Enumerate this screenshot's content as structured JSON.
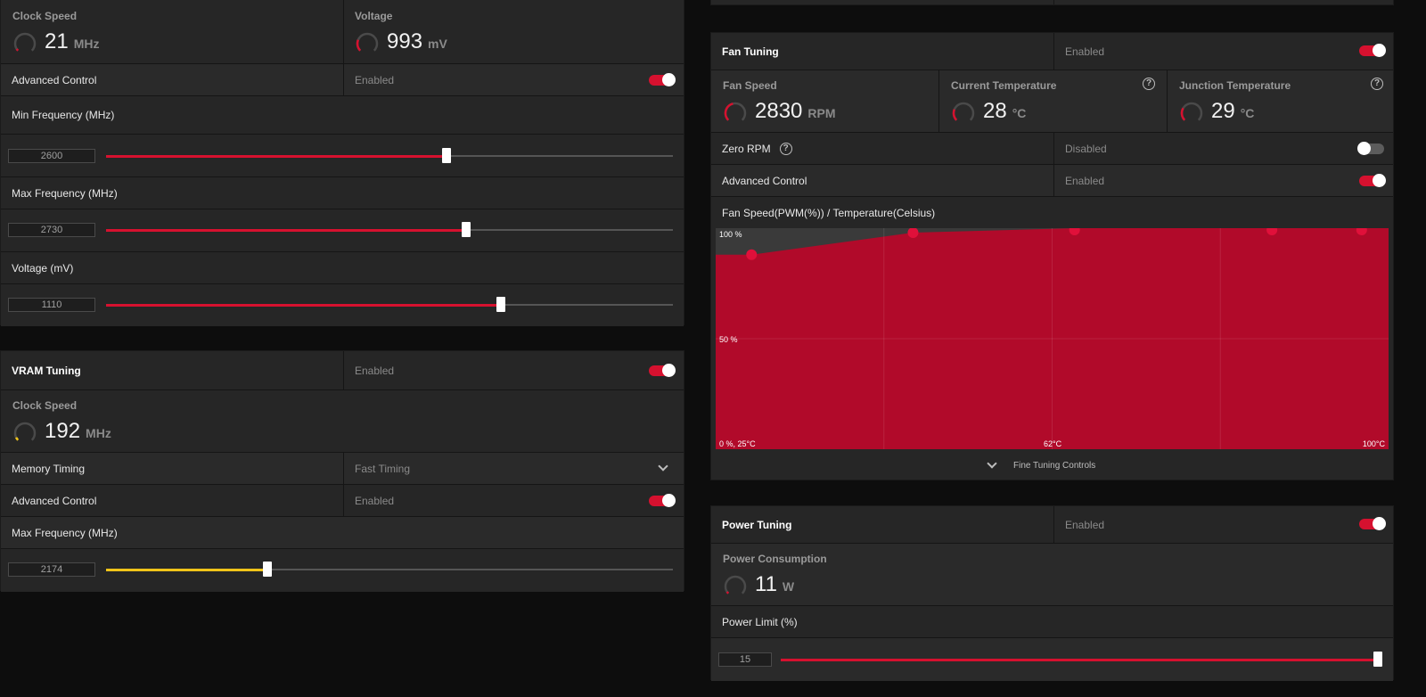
{
  "gpu": {
    "clock": {
      "title": "Clock Speed",
      "value": "21",
      "unit": "MHz",
      "level": 0.0
    },
    "voltage": {
      "title": "Voltage",
      "value": "993",
      "unit": "mV",
      "level": 0.25
    },
    "advanced_label": "Advanced Control",
    "advanced_state": "Enabled",
    "advanced_on": true,
    "sliders": [
      {
        "label": "Min Frequency (MHz)",
        "value": "2600",
        "fraction": 0.6
      },
      {
        "label": "Max Frequency (MHz)",
        "value": "2730",
        "fraction": 0.635
      },
      {
        "label": "Voltage (mV)",
        "value": "1110",
        "fraction": 0.697
      }
    ]
  },
  "vram": {
    "title": "VRAM Tuning",
    "state": "Enabled",
    "on": true,
    "clock": {
      "title": "Clock Speed",
      "value": "192",
      "unit": "MHz",
      "level": 0.07
    },
    "memory_timing_label": "Memory Timing",
    "memory_timing_value": "Fast Timing",
    "advanced_label": "Advanced Control",
    "advanced_state": "Enabled",
    "advanced_on": true,
    "max_freq": {
      "label": "Max Frequency (MHz)",
      "value": "2174",
      "fraction": 0.284
    }
  },
  "fan": {
    "title": "Fan Tuning",
    "state": "Enabled",
    "on": true,
    "speed": {
      "title": "Fan Speed",
      "value": "2830",
      "unit": "RPM",
      "level": 0.45
    },
    "current_temp": {
      "title": "Current Temperature",
      "value": "28",
      "unit": "°C",
      "level": 0.25
    },
    "junction_temp": {
      "title": "Junction Temperature",
      "value": "29",
      "unit": "°C",
      "level": 0.28
    },
    "zero_rpm_label": "Zero RPM",
    "zero_rpm_state": "Disabled",
    "zero_rpm_on": false,
    "advanced_label": "Advanced Control",
    "advanced_state": "Enabled",
    "advanced_on": true,
    "curve_title": "Fan Speed(PWM(%)) / Temperature(Celsius)",
    "fine_tuning_label": "Fine Tuning Controls",
    "colors": {
      "curve_fill": "#b10a2a",
      "point": "#e0103a"
    }
  },
  "chart_data": {
    "type": "area",
    "x": [
      29,
      47,
      65,
      87,
      97
    ],
    "y": [
      88,
      98,
      100,
      100,
      100
    ],
    "xlim": [
      25,
      100
    ],
    "ylim": [
      0,
      100
    ],
    "tick_labels": {
      "top": "100 %",
      "mid": "50 %",
      "origin": "0 %, 25°C",
      "center": "62°C",
      "right": "100°C"
    },
    "grid": true
  },
  "power": {
    "title": "Power Tuning",
    "state": "Enabled",
    "on": true,
    "consumption": {
      "title": "Power Consumption",
      "value": "11",
      "unit": "W",
      "level": 0.03
    },
    "limit": {
      "label": "Power Limit (%)",
      "value": "15",
      "fraction": 1.0
    }
  },
  "colors": {
    "accent": "#d6112f",
    "vram_accent": "#f0c419",
    "panel": "#262626",
    "background": "#0d0d0d"
  }
}
